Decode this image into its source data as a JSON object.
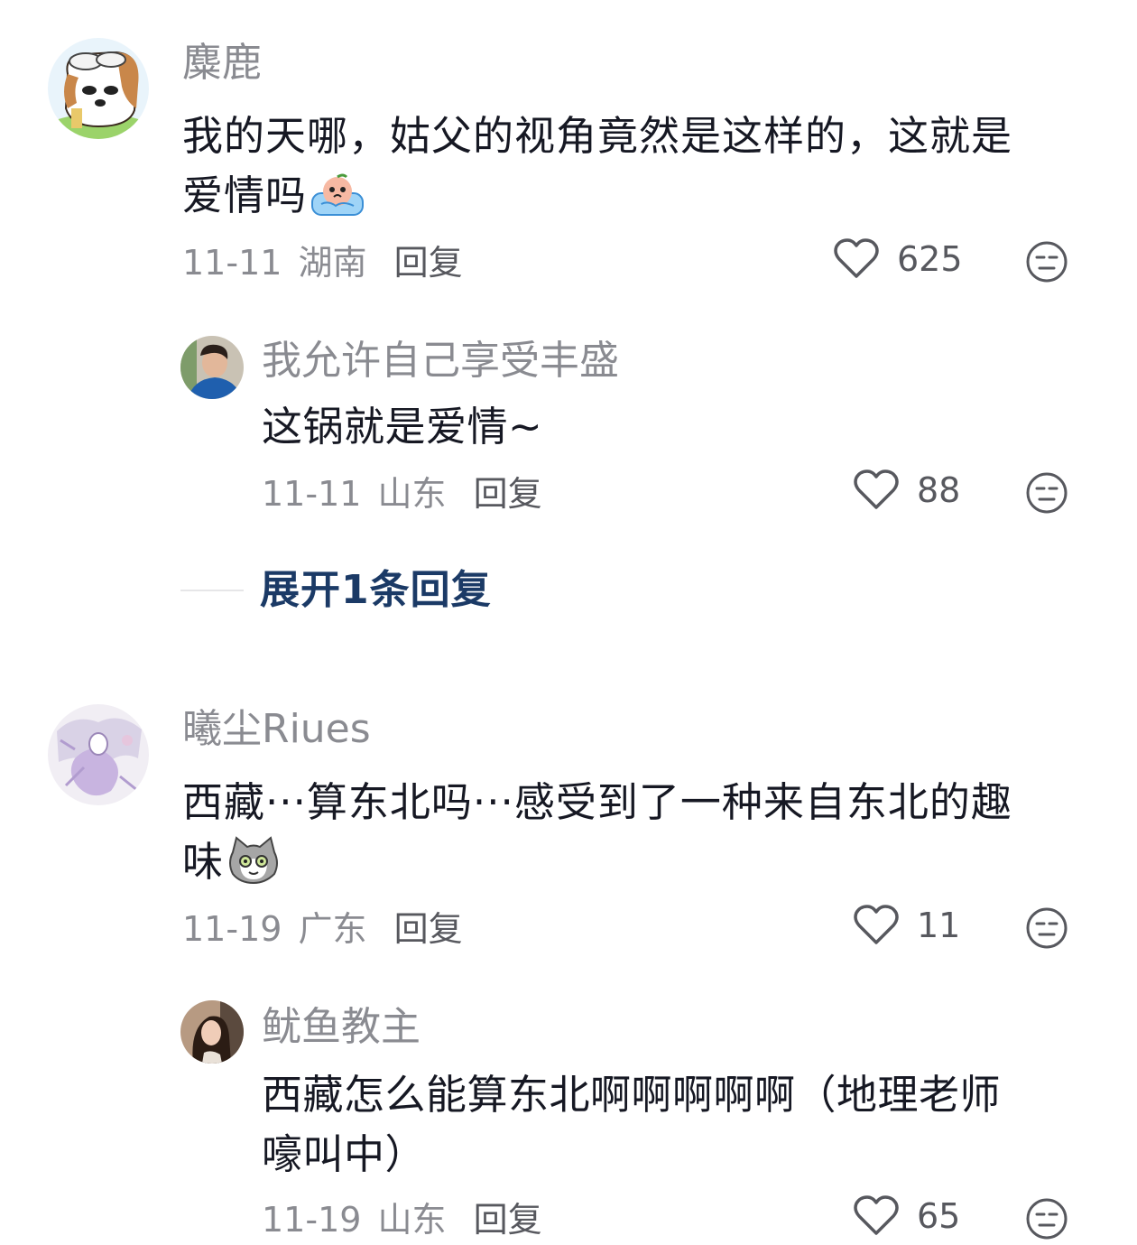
{
  "comments": [
    {
      "author": "麋鹿",
      "text_line1": "我的天哪，姑父的视角竟然是这样的，这就是",
      "text_line2": "爱情吗",
      "emoji": "crying-emoji",
      "date": "11-11",
      "location": "湖南",
      "reply_label": "回复",
      "likes": "625"
    },
    {
      "author": "我允许自己享受丰盛",
      "text_line1": "这锅就是爱情~",
      "date": "11-11",
      "location": "山东",
      "reply_label": "回复",
      "likes": "88",
      "is_reply": true
    },
    {
      "author": "曦尘Riues",
      "text_line1": "西藏···算东北吗···感受到了一种来自东北的趣",
      "text_line2": "味",
      "emoji": "cat-emoji",
      "date": "11-19",
      "location": "广东",
      "reply_label": "回复",
      "likes": "11"
    },
    {
      "author": "鱿鱼教主",
      "text_line1": "西藏怎么能算东北啊啊啊啊啊（地理老师",
      "text_line2": "嚎叫中）",
      "date": "11-19",
      "location": "山东",
      "reply_label": "回复",
      "likes": "65",
      "is_reply": true
    }
  ],
  "expand_replies_label": "展开1条回复",
  "colors": {
    "author_gray": "#8a8b91",
    "text_dark": "#161823",
    "expand_blue": "#1b3a66"
  }
}
